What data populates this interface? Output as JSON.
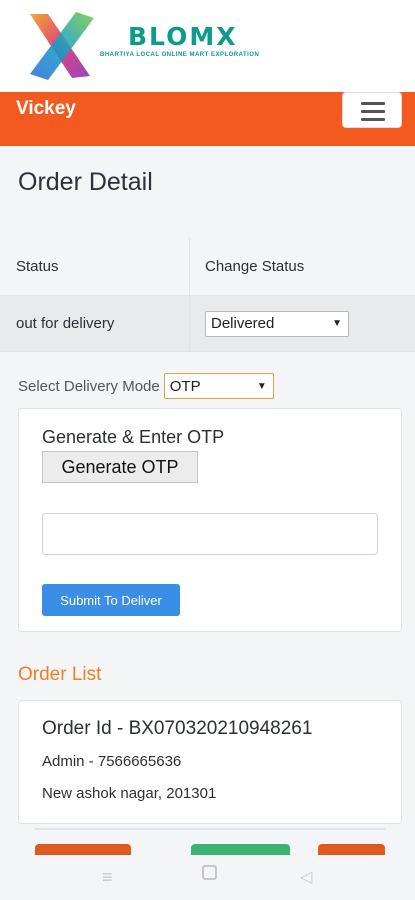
{
  "brand": {
    "name": "BLOMX",
    "tagline": "BHARTIYA LOCAL ONLINE MART EXPLORATION",
    "logo_icon": "blomx-x-logo-icon"
  },
  "nav": {
    "user_name": "Vickey",
    "menu_icon": "hamburger-menu-icon",
    "bar_color": "#f35a1f"
  },
  "page": {
    "title": "Order Detail"
  },
  "status_table": {
    "headers": [
      "Status",
      "Change Status"
    ],
    "current_status": "out for delivery",
    "change_status_value": "Delivered"
  },
  "delivery": {
    "label": "Select Delivery Mode",
    "mode_value": "OTP"
  },
  "otp": {
    "heading": "Generate & Enter OTP",
    "generate_label": "Generate OTP",
    "input_value": "",
    "submit_label": "Submit To Deliver"
  },
  "orders": {
    "title": "Order List",
    "items": [
      {
        "order_id": "Order Id - BX070320210948261",
        "contact": "Admin - 7566665636",
        "address": "New ashok nagar, 201301"
      }
    ]
  },
  "colors": {
    "accent_orange": "#f07f24",
    "primary_blue": "#3a8ee6",
    "brand_teal": "#0c9b8c",
    "action_green": "#3cb371",
    "action_orange": "#e05a1f"
  },
  "system_nav": {
    "icons": [
      "recent-apps-icon",
      "home-icon",
      "back-icon"
    ]
  }
}
